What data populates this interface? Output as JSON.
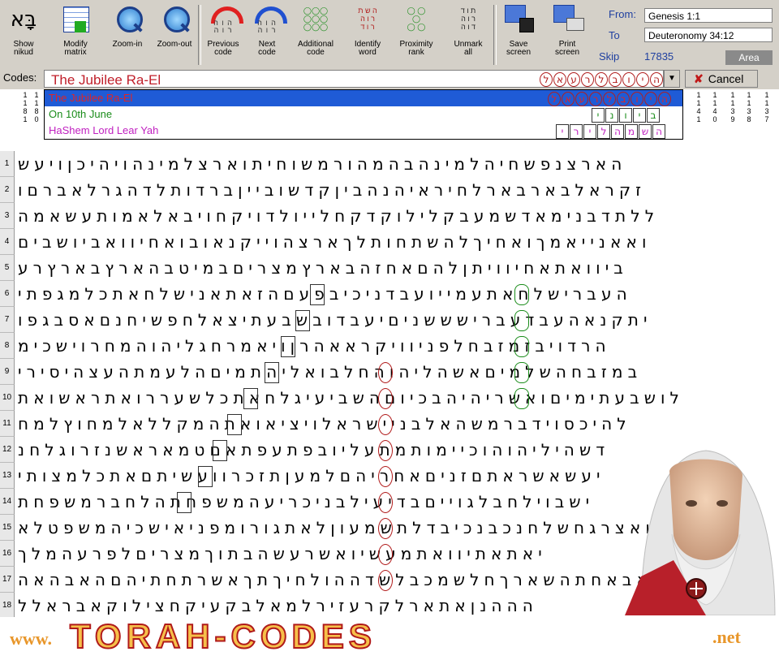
{
  "toolbar": {
    "buttons": [
      {
        "label": "Show\nnikud"
      },
      {
        "label": "Modify\nmatrix"
      },
      {
        "label": "Zoom-in"
      },
      {
        "label": "Zoom-out"
      },
      {
        "label": "Previous\ncode"
      },
      {
        "label": "Next\ncode"
      },
      {
        "label": "Additional\ncode"
      },
      {
        "label": "Identify\nword"
      },
      {
        "label": "Proximity\nrank"
      },
      {
        "label": "Unmark\nall"
      },
      {
        "label": "Save\nscreen"
      },
      {
        "label": "Print\nscreen"
      }
    ],
    "nikud_glyph": "בָּא"
  },
  "range": {
    "from_label": "From:",
    "from_value": "Genesis 1:1",
    "to_label": "To",
    "to_value": "Deuteronomy 34:12",
    "skip_label": "Skip",
    "skip_value": "17835",
    "area_label": "Area"
  },
  "codes": {
    "label": "Codes:",
    "value": "The Jubilee Ra-El",
    "value_hebrew": "היובלרעאל",
    "cancel_label": "Cancel",
    "list": [
      {
        "text": "The Jubilee Ra-El",
        "hebrew": "היובלרעאל",
        "color": "#e02525"
      },
      {
        "text": "On 10th June",
        "hebrew": "ביוני",
        "color": "#1a8c1a"
      },
      {
        "text": "HaShem Lord Lear Yah",
        "hebrew": "השמהלירי",
        "color": "#c020c0"
      }
    ]
  },
  "columns": {
    "left": [
      "1\n1\n8\n1",
      "1\n1\n8\n0"
    ],
    "right": [
      "1\n1\n4\n1",
      "1\n1\n4\n0",
      "1\n1\n3\n9",
      "1\n1\n3\n8",
      "1\n1\n3\n7"
    ]
  },
  "matrix": {
    "rows": [
      "הארצנפשחיהלמינהבהמהורמשוחיתוארצלמינהויהיכןויעש",
      "זקראלבארבארלחיראיהנהביןקדשובייןברדותלדהגרלאברםו",
      "ללתדבנימאדשמעבקלילוקדקחלייולדויקחויבאלאמותעשאמה",
      "ואאנייאמךואחיךלהשתחותלךארצהוייקנאובואחיוואביושבים",
      "ביוואתאחיוויתןלהםאחזהבארץמצריםבמיטבהארץבארץרע",
      "העברישלחאתעמייועבדניכיבפעםהזאתאנישלחאתכלמגפתי",
      "יתקנאהעבדעברישששניםיעבדובשבעתיצאלחפשיחנםאסבגפו",
      "הרדויבזמזבחלפניוויקראאהרןויאמרחגליהוהמחרוישכימ",
      "במזבחהשלמיםאשהליהוהחלבואליהתמיםהלעמתהעצהיסירי",
      "לושבעתימיםואשריהיהבכיוםהשביעיגלחאתכלשעררואתראשואת",
      "להיכסוידברמשהאלבניישראלויציאואתהמקללאלמחוץלמח",
      "דשהיליהוהוכיימותמתעליובפתעפתאםטמאראשנזרוגלחנ",
      "יעשאשראתםזניםאחריהםלמעןתזכרוועשיתםאתכלמצותי",
      "ישבוילחבלגוייםבדיעילבניכריעהמשפחתהלחברמשפחת",
      "ואצרגחשלחנכבנכיבדלתשמעוןלאתגורומפניאישכיהמשפטלא",
      "יאתאתיוואתמעשיואשרעשהבתוךמצריםלפרעהמלך",
      "אבאחתהשארךחלשמכבלשדההולחיךתךאשרתחתיהםהאבהאה",
      "הההנןאתארלקרעזירלמאלבקעיקחצילוקאבראלל"
    ]
  },
  "banner": {
    "www": "www.",
    "main": "TORAH-CODES",
    "net": ".net"
  },
  "colors": {
    "accent": "#1f5bd6",
    "code_red": "#e02525",
    "code_green": "#1a8c1a",
    "code_purple": "#c020c0",
    "toolbar_bg": "#d4d0c8"
  }
}
